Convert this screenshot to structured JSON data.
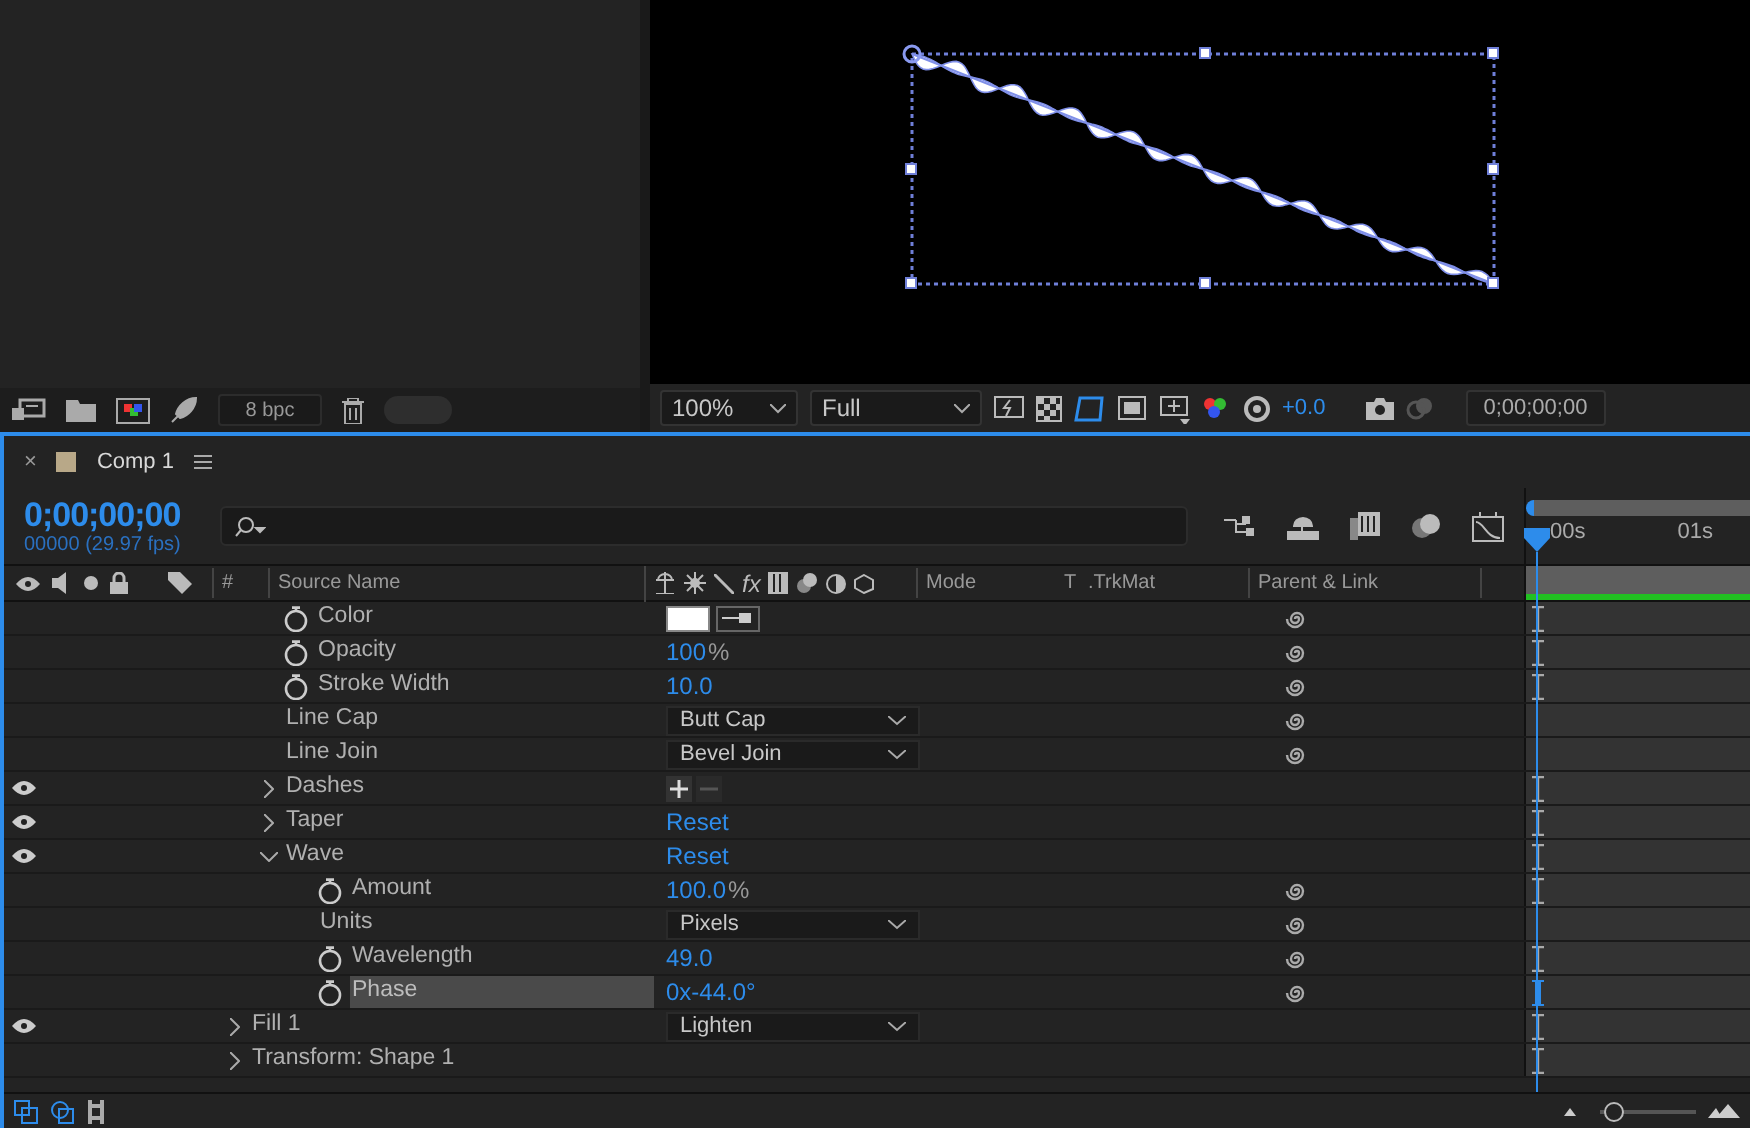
{
  "project_panel": {
    "bit_depth": "8 bpc"
  },
  "viewer": {
    "zoom": "100%",
    "resolution": "Full",
    "exposure": "+0.0",
    "timecode": "0;00;00;00"
  },
  "timeline": {
    "close_glyph": "×",
    "zoom_slider": {
      "level": 0.05
    },
    "tab": {
      "label": "Comp 1",
      "selected": true
    },
    "current_time": "0;00;00;00",
    "frame_info": "00000 (29.97 fps)",
    "columns": {
      "number": "#",
      "source_name": "Source Name",
      "fx": "fx",
      "mode": "Mode",
      "t": "T",
      "trkmat": ".TrkMat",
      "parent": "Parent & Link"
    },
    "ruler": [
      "00s",
      "01s"
    ],
    "properties": [
      {
        "children": [
          {
            "name": "Color",
            "kind": "color",
            "stopwatch": true,
            "eye": false,
            "pickwhip": true,
            "keyframes": true,
            "selected": false,
            "color": "#ffffff"
          },
          {
            "name": "Opacity",
            "kind": "number",
            "stopwatch": true,
            "eye": false,
            "pickwhip": true,
            "keyframes": true,
            "selected": false,
            "value": "100",
            "unit": "%"
          },
          {
            "name": "Stroke Width",
            "kind": "number",
            "stopwatch": true,
            "eye": false,
            "pickwhip": true,
            "keyframes": true,
            "selected": false,
            "value": "10.0"
          },
          {
            "name": "Line Cap",
            "kind": "dropdown",
            "stopwatch": false,
            "eye": false,
            "pickwhip": true,
            "keyframes": false,
            "selected": false,
            "value": "Butt Cap"
          },
          {
            "name": "Line Join",
            "kind": "dropdown",
            "stopwatch": false,
            "eye": false,
            "pickwhip": true,
            "keyframes": false,
            "selected": false,
            "value": "Bevel Join"
          },
          {
            "name": "Dashes",
            "kind": "add-remove",
            "stopwatch": false,
            "eye": true,
            "expanded": false,
            "pickwhip": false,
            "keyframes": true,
            "selected": false
          },
          {
            "name": "Taper",
            "kind": "link",
            "stopwatch": false,
            "eye": true,
            "expanded": false,
            "pickwhip": false,
            "keyframes": true,
            "selected": false,
            "value": "Reset"
          },
          {
            "name": "Wave",
            "kind": "link",
            "stopwatch": false,
            "eye": true,
            "expanded": true,
            "pickwhip": false,
            "keyframes": true,
            "selected": false,
            "value": "Reset",
            "children": [
              {
                "name": "Amount",
                "kind": "number",
                "stopwatch": true,
                "eye": false,
                "pickwhip": true,
                "keyframes": true,
                "selected": false,
                "value": "100.0",
                "unit": "%"
              },
              {
                "name": "Units",
                "kind": "dropdown",
                "stopwatch": false,
                "eye": false,
                "pickwhip": true,
                "keyframes": false,
                "selected": false,
                "value": "Pixels"
              },
              {
                "name": "Wavelength",
                "kind": "number",
                "stopwatch": true,
                "eye": false,
                "pickwhip": true,
                "keyframes": true,
                "selected": false,
                "value": "49.0"
              },
              {
                "name": "Phase",
                "kind": "number",
                "stopwatch": true,
                "eye": false,
                "pickwhip": true,
                "keyframes": true,
                "selected": true,
                "value": "0x-44.0°"
              }
            ]
          }
        ]
      },
      {
        "name": "Fill 1",
        "kind": "dropdown",
        "stopwatch": false,
        "eye": true,
        "expanded": false,
        "pickwhip": false,
        "keyframes": true,
        "selected": false,
        "value": "Lighten"
      },
      {
        "name": "Transform: Shape 1",
        "kind": "none",
        "stopwatch": false,
        "eye": false,
        "expanded": false,
        "pickwhip": false,
        "keyframes": true,
        "selected": false
      }
    ]
  }
}
